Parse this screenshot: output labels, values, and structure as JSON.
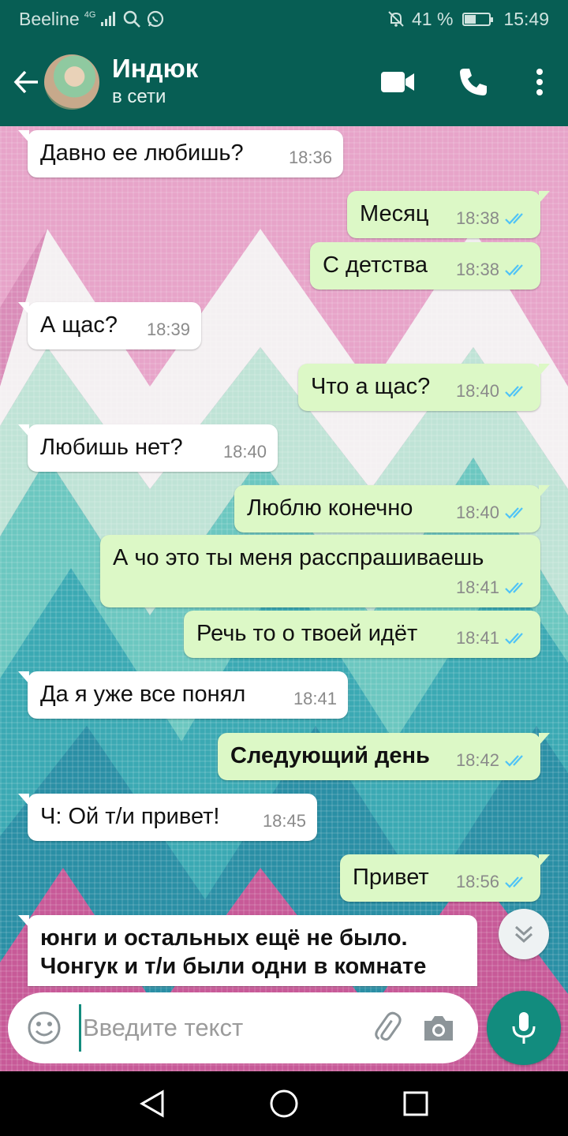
{
  "status_bar": {
    "carrier": "Beeline",
    "network": "4G",
    "battery": "41 %",
    "battery_level": 0.41,
    "time": "15:49",
    "icons": [
      "signal-icon",
      "search-icon",
      "whatsapp-icon",
      "mute-icon",
      "battery-icon"
    ]
  },
  "header": {
    "contact_name": "Индюк",
    "contact_status": "в сети",
    "icons": [
      "back-arrow-icon",
      "avatar",
      "video-call-icon",
      "phone-icon",
      "more-vert-icon"
    ]
  },
  "messages": [
    {
      "dir": "in",
      "text": "Давно ее любишь?",
      "time": "18:36"
    },
    {
      "dir": "out",
      "text": "Месяц",
      "time": "18:38",
      "read": true
    },
    {
      "dir": "out",
      "text": "С детства",
      "time": "18:38",
      "read": true
    },
    {
      "dir": "in",
      "text": "А щас?",
      "time": "18:39"
    },
    {
      "dir": "out",
      "text": "Что а щас?",
      "time": "18:40",
      "read": true
    },
    {
      "dir": "in",
      "text": "Любишь нет?",
      "time": "18:40"
    },
    {
      "dir": "out",
      "text": "Люблю конечно",
      "time": "18:40",
      "read": true
    },
    {
      "dir": "out",
      "text": "А чо это ты меня расспрашиваешь",
      "time": "18:41",
      "read": true
    },
    {
      "dir": "out",
      "text": "Речь то о твоей идёт",
      "time": "18:41",
      "read": true
    },
    {
      "dir": "in",
      "text": "Да я уже все понял",
      "time": "18:41"
    },
    {
      "dir": "out",
      "text": "Следующий день",
      "time": "18:42",
      "read": true,
      "bold": true
    },
    {
      "dir": "in",
      "text": "Ч: Ой т/и привет!",
      "time": "18:45"
    },
    {
      "dir": "out",
      "text": "Привет",
      "time": "18:56",
      "read": true
    },
    {
      "dir": "in",
      "text_line1": "юнги и остальных ещё не было.",
      "text_line2": "Чонгук и  т/и были одни в комнате",
      "bold": true
    }
  ],
  "input": {
    "placeholder": "Введите текст",
    "icons": [
      "emoji-icon",
      "attach-icon",
      "camera-icon",
      "mic-icon",
      "scroll-down-icon"
    ]
  },
  "nav": {
    "icons": [
      "nav-back-icon",
      "nav-home-icon",
      "nav-recents-icon"
    ]
  },
  "colors": {
    "header": "#075e54",
    "out_bubble": "#dcf8c6",
    "in_bubble": "#ffffff",
    "read_ticks": "#4fc3f7",
    "accent": "#128c7e"
  }
}
